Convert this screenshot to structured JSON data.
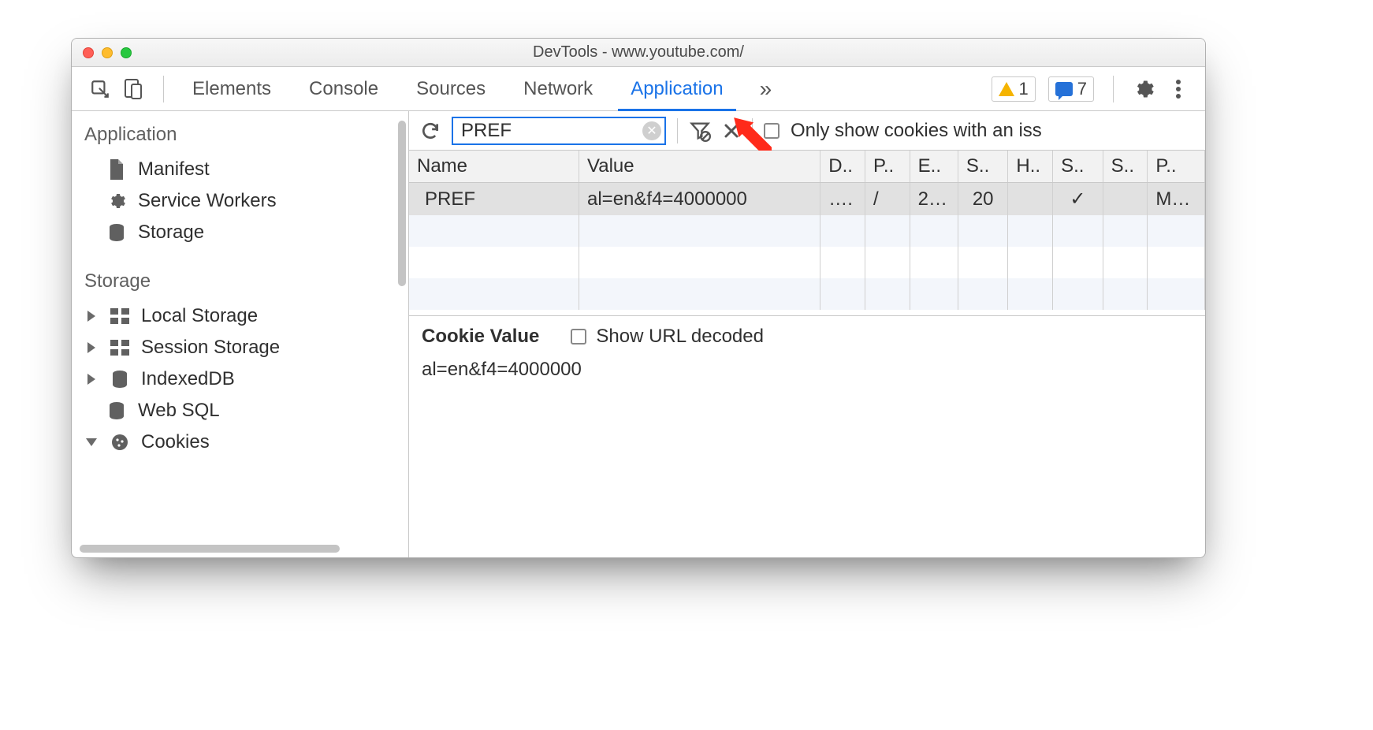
{
  "titlebar": {
    "title": "DevTools - www.youtube.com/"
  },
  "tabs": {
    "items": [
      "Elements",
      "Console",
      "Sources",
      "Network",
      "Application"
    ],
    "active_index": 4
  },
  "badges": {
    "warnings": "1",
    "messages": "7"
  },
  "sidebar": {
    "sections": [
      {
        "title": "Application",
        "items": [
          {
            "label": "Manifest",
            "icon": "file"
          },
          {
            "label": "Service Workers",
            "icon": "gear"
          },
          {
            "label": "Storage",
            "icon": "db"
          }
        ]
      },
      {
        "title": "Storage",
        "items": [
          {
            "label": "Local Storage",
            "icon": "grid",
            "expandable": true
          },
          {
            "label": "Session Storage",
            "icon": "grid",
            "expandable": true
          },
          {
            "label": "IndexedDB",
            "icon": "db",
            "expandable": true
          },
          {
            "label": "Web SQL",
            "icon": "db"
          },
          {
            "label": "Cookies",
            "icon": "cookie",
            "expandable": true,
            "expanded": true
          }
        ]
      }
    ]
  },
  "toolbar": {
    "filter_value": "PREF",
    "only_issue_label": "Only show cookies with an iss"
  },
  "table": {
    "columns": [
      "Name",
      "Value",
      "D..",
      "P..",
      "E..",
      "S..",
      "H..",
      "S..",
      "S..",
      "P.."
    ],
    "rows": [
      {
        "name": "PREF",
        "value": "al=en&f4=4000000",
        "domain": "….",
        "path": "/",
        "expires": "2…",
        "size": "20",
        "http": "",
        "secure": "✓",
        "same": "",
        "priority": "M…"
      }
    ]
  },
  "detail": {
    "heading": "Cookie Value",
    "decode_label": "Show URL decoded",
    "value": "al=en&f4=4000000"
  }
}
